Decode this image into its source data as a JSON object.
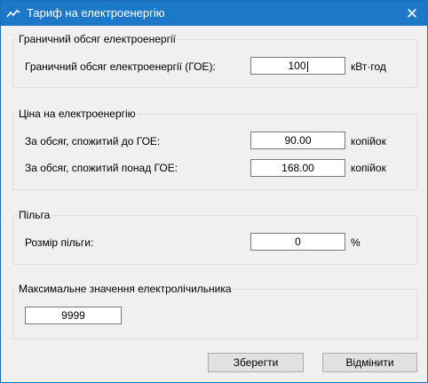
{
  "window": {
    "title": "Тариф на електроенергію",
    "app_icon": "chart-line-icon",
    "close_icon": "close-icon"
  },
  "limit_group": {
    "title": "Граничний обсяг електроенергії",
    "field_label": "Граничний обсяг електроенергії (ГОЕ):",
    "value": "100",
    "unit": "кВт·год"
  },
  "price_group": {
    "title": "Ціна на електроенергію",
    "below_label": "За обсяг, спожитий до ГОЕ:",
    "below_value": "90.00",
    "below_unit": "копійок",
    "above_label": "За обсяг, спожитий понад ГОЕ:",
    "above_value": "168.00",
    "above_unit": "копійок"
  },
  "benefit_group": {
    "title": "Пільга",
    "field_label": "Розмір пільги:",
    "value": "0",
    "unit": "%"
  },
  "meter_group": {
    "title": "Максимальне значення електролічильника",
    "value": "9999"
  },
  "buttons": {
    "save": "Зберегти",
    "cancel": "Відмінити"
  }
}
